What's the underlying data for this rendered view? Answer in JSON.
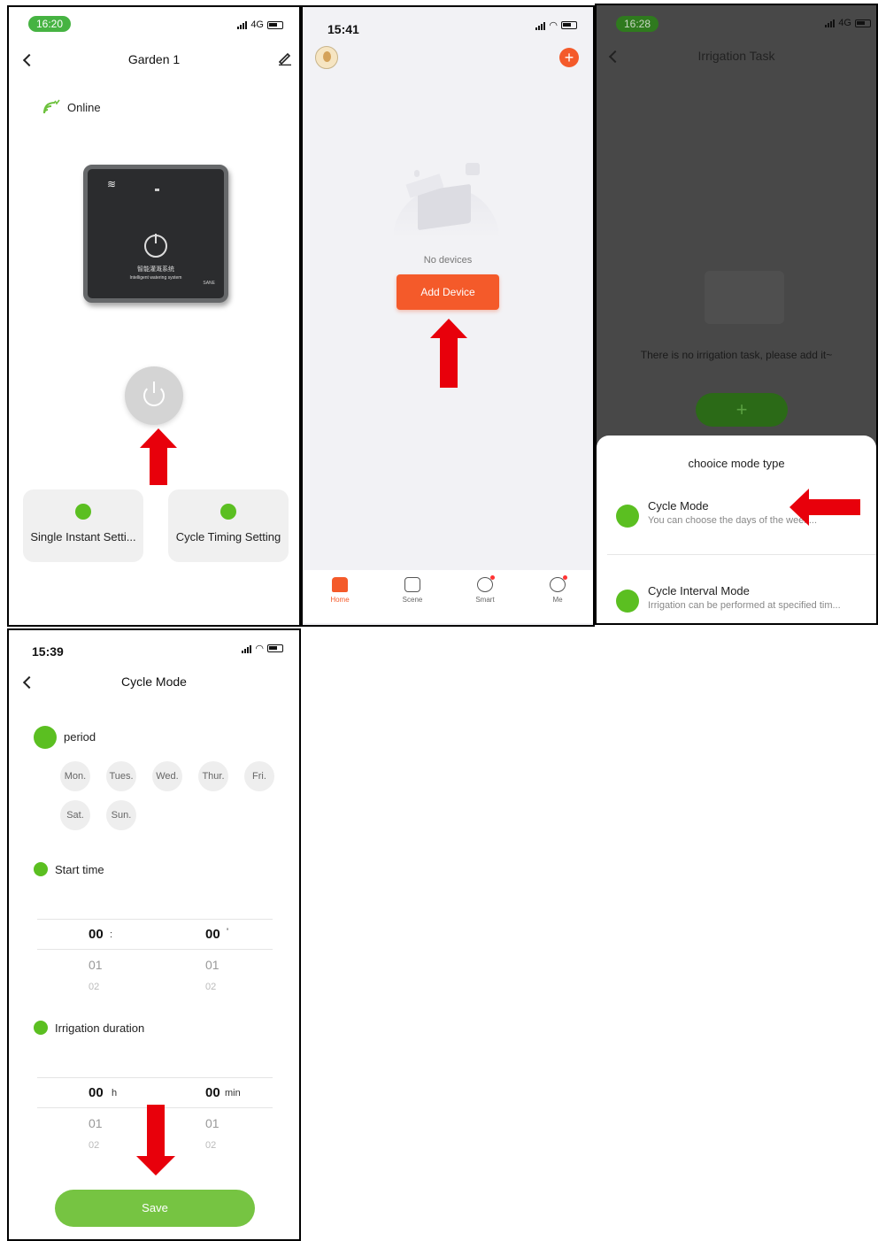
{
  "colors": {
    "accent_green": "#5bbf21",
    "accent_orange": "#f45a2a",
    "annotation_red": "#e8000b"
  },
  "panel1": {
    "time": "16:20",
    "network": "4G",
    "title": "Garden 1",
    "online_label": "Online",
    "device_caption_cn": "智能灌溉系统",
    "device_caption_en": "Intelligent watering system",
    "device_brand": "SANE",
    "buttons": [
      {
        "label": "Single Instant Setti...",
        "icon": "stopwatch-icon"
      },
      {
        "label": "Cycle Timing Setting",
        "icon": "alarm-clock-icon"
      }
    ]
  },
  "panel2": {
    "time": "15:41",
    "empty_text": "No devices",
    "add_button": "Add Device",
    "tabs": [
      {
        "label": "Home",
        "icon": "home-icon"
      },
      {
        "label": "Scene",
        "icon": "scene-icon"
      },
      {
        "label": "Smart",
        "icon": "smart-icon"
      },
      {
        "label": "Me",
        "icon": "profile-icon"
      }
    ]
  },
  "panel3": {
    "time": "16:28",
    "network": "4G",
    "title": "Irrigation Task",
    "empty_text": "There is no irrigation task, please add it~",
    "add_symbol": "+",
    "sheet_title": "chooice mode type",
    "options": [
      {
        "title": "Cycle Mode",
        "desc": "You can choose the days of the week..."
      },
      {
        "title": "Cycle Interval Mode",
        "desc": "Irrigation can be performed at specified tim..."
      }
    ]
  },
  "panel4": {
    "time": "15:39",
    "title": "Cycle Mode",
    "period_label": "period",
    "days": [
      "Mon.",
      "Tues.",
      "Wed.",
      "Thur.",
      "Fri.",
      "Sat.",
      "Sun."
    ],
    "start_time_label": "Start time",
    "start_picker": {
      "hour": [
        "00",
        "01",
        "02"
      ],
      "minute": [
        "00",
        "01",
        "02"
      ],
      "sep_hour": ":",
      "sep_min": "'"
    },
    "duration_label": "Irrigation duration",
    "duration_picker": {
      "hour": [
        "00",
        "01",
        "02"
      ],
      "minute": [
        "00",
        "01",
        "02"
      ],
      "unit_h": "h",
      "unit_min": "min"
    },
    "save_button": "Save"
  }
}
